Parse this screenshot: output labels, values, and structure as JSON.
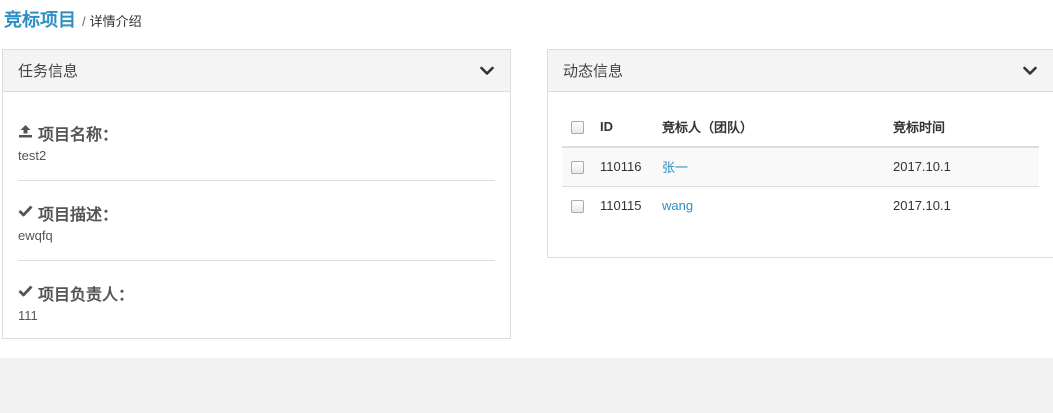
{
  "breadcrumb": {
    "main": "竞标项目",
    "separator": "/",
    "sub": "详情介绍"
  },
  "task_panel": {
    "title": "任务信息",
    "items": [
      {
        "icon": "upload-icon",
        "label": "项目名称：",
        "value": "test2"
      },
      {
        "icon": "check-icon",
        "label": "项目描述：",
        "value": "ewqfq"
      },
      {
        "icon": "check-icon",
        "label": "项目负责人：",
        "value": "111"
      }
    ]
  },
  "dynamic_panel": {
    "title": "动态信息",
    "headers": {
      "id": "ID",
      "bidder": "竞标人（团队）",
      "time": "竞标时间"
    },
    "rows": [
      {
        "id": "110116",
        "bidder": "张一",
        "time": "2017.10.1"
      },
      {
        "id": "110115",
        "bidder": "wang",
        "time": "2017.10.1"
      }
    ]
  },
  "colors": {
    "accent": "#2d8fc4",
    "panel_header_bg": "#f4f4f4",
    "footer_bg": "#f1f1f1"
  }
}
